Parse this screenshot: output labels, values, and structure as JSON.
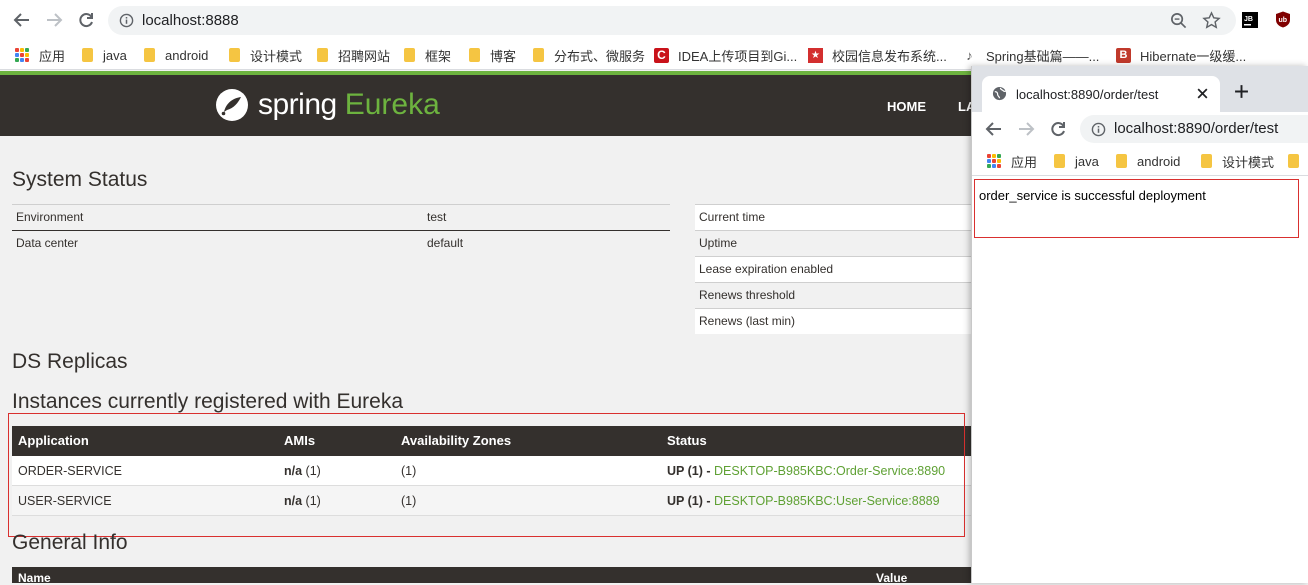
{
  "main_browser": {
    "url": "localhost:8888",
    "bookmarks": [
      {
        "label": "应用",
        "icon": "apps-icon"
      },
      {
        "label": "java",
        "icon": "folder-icon"
      },
      {
        "label": "android",
        "icon": "folder-icon"
      },
      {
        "label": "设计模式",
        "icon": "folder-icon"
      },
      {
        "label": "招聘网站",
        "icon": "folder-icon"
      },
      {
        "label": "框架",
        "icon": "folder-icon"
      },
      {
        "label": "博客",
        "icon": "folder-icon"
      },
      {
        "label": "分布式、微服务",
        "icon": "folder-icon"
      },
      {
        "label": "IDEA上传项目到Gi...",
        "icon": "csdn-icon"
      },
      {
        "label": "校园信息发布系统...",
        "icon": "site-icon"
      },
      {
        "label": "Spring基础篇——...",
        "icon": "site-icon"
      },
      {
        "label": "Hibernate一级缓...",
        "icon": "site-icon"
      }
    ]
  },
  "eureka": {
    "logo_spring": "spring",
    "logo_eureka": "Eureka",
    "nav": {
      "home": "HOME",
      "last": "LA"
    },
    "system_status_title": "System Status",
    "left_table": [
      {
        "key": "Environment",
        "value": "test"
      },
      {
        "key": "Data center",
        "value": "default"
      }
    ],
    "right_table": [
      {
        "key": "Current time"
      },
      {
        "key": "Uptime"
      },
      {
        "key": "Lease expiration enabled"
      },
      {
        "key": "Renews threshold"
      },
      {
        "key": "Renews (last min)"
      }
    ],
    "ds_replicas_title": "DS Replicas",
    "instances_title": "Instances currently registered with Eureka",
    "instances_headers": {
      "application": "Application",
      "amis": "AMIs",
      "zones": "Availability Zones",
      "status": "Status"
    },
    "instances": [
      {
        "application": "ORDER-SERVICE",
        "amis_bold": "n/a",
        "amis_count": "(1)",
        "zones": "(1)",
        "status_prefix": "UP (1) - ",
        "status_link": "DESKTOP-B985KBC:Order-Service:8890"
      },
      {
        "application": "USER-SERVICE",
        "amis_bold": "n/a",
        "amis_count": "(1)",
        "zones": "(1)",
        "status_prefix": "UP (1) - ",
        "status_link": "DESKTOP-B985KBC:User-Service:8889"
      }
    ],
    "general_info_title": "General Info",
    "general_headers": {
      "name": "Name",
      "value": "Value"
    }
  },
  "popup": {
    "tab_title": "localhost:8890/order/test",
    "url": "localhost:8890/order/test",
    "bookmarks": [
      {
        "label": "应用",
        "icon": "apps-icon"
      },
      {
        "label": "java",
        "icon": "folder-icon"
      },
      {
        "label": "android",
        "icon": "folder-icon"
      },
      {
        "label": "设计模式",
        "icon": "folder-icon"
      }
    ],
    "content": "order_service is successful deployment"
  },
  "colors": {
    "spring_green": "#6db33f",
    "navbar": "#34302d",
    "highlight_red": "#d9302f",
    "link_green": "#5fa134"
  }
}
